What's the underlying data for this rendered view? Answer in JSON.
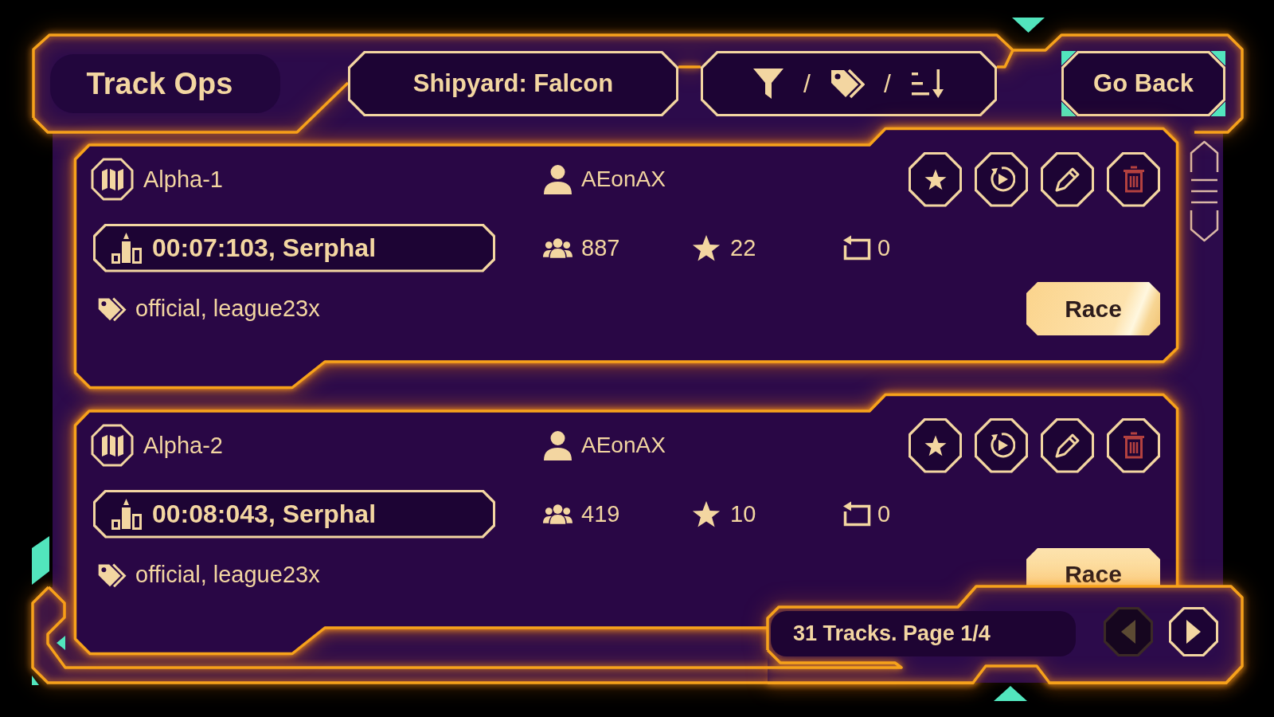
{
  "header": {
    "title": "Track Ops",
    "shipyard_button": "Shipyard: Falcon",
    "filter_button": {
      "separators": [
        "/",
        "/"
      ]
    },
    "back_button": "Go Back"
  },
  "tracks": [
    {
      "name": "Alpha-1",
      "author": "AEonAX",
      "record": "00:07:103, Serphal",
      "player_count": "887",
      "star_count": "22",
      "repeat_count": "0",
      "tags": "official, league23x",
      "race_button": "Race"
    },
    {
      "name": "Alpha-2",
      "author": "AEonAX",
      "record": "00:08:043, Serphal",
      "player_count": "419",
      "star_count": "10",
      "repeat_count": "0",
      "tags": "official, league23x",
      "race_button": "Race"
    }
  ],
  "pagination": {
    "summary": "31 Tracks. Page 1/4",
    "previous_button": {
      "disabled": true
    },
    "next_button": {
      "disabled": false
    }
  }
}
